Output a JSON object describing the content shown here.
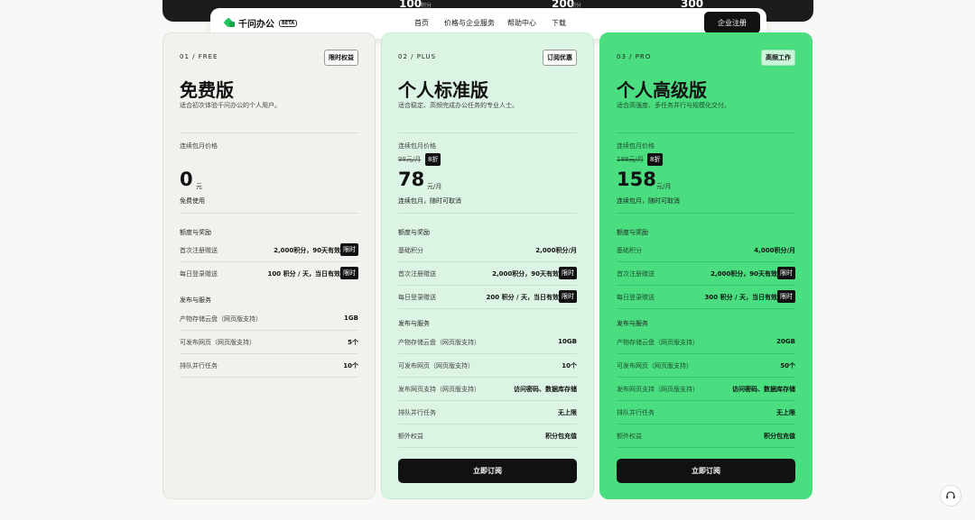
{
  "top_strip": {
    "n1": "100",
    "n2": "200",
    "n3": "300",
    "sub1": "积分",
    "sub2": "积分"
  },
  "nav": {
    "logo_text": "千问办公",
    "beta": "BETA",
    "items": [
      "首页",
      "价格与企业服务",
      "帮助中心",
      "下载"
    ],
    "active": "价格与企业服务",
    "cta": "企业注册"
  },
  "plans": {
    "free": {
      "code": "01 / FREE",
      "tag": "限时权益",
      "name": "免费版",
      "desc": "适合初次体验千问办公的个人用户。",
      "price_label": "连续包月价格",
      "price": "0",
      "unit": "元",
      "note": "免费使用",
      "sec1": "额度与奖励",
      "rows1": [
        {
          "k": "首次注册赠送",
          "v": "2,000积分，90天有效",
          "badge": "限时"
        },
        {
          "k": "每日登录赠送",
          "v": "100 积分 / 天，当日有效",
          "badge": "限时"
        }
      ],
      "sec2": "发布与服务",
      "rows2": [
        {
          "k": "产物存储云盘（网页版支持）",
          "v": "1GB"
        },
        {
          "k": "可发布网页（网页版支持）",
          "v": "5个"
        },
        {
          "k": "排队并行任务",
          "v": "10个"
        }
      ]
    },
    "plus": {
      "code": "02 / PLUS",
      "tag": "订阅优惠",
      "name": "个人标准版",
      "desc": "适合稳定、高频完成办公任务的专业人士。",
      "price_label": "连续包月价格",
      "orig": "98元/月",
      "discount": "8折",
      "price": "78",
      "unit": "元/月",
      "note": "连续包月，随时可取消",
      "sec1": "额度与奖励",
      "rows1": [
        {
          "k": "基础积分",
          "v": "2,000积分/月"
        },
        {
          "k": "首次注册赠送",
          "v": "2,000积分，90天有效",
          "badge": "限时"
        },
        {
          "k": "每日登录赠送",
          "v": "200 积分 / 天，当日有效",
          "badge": "限时"
        }
      ],
      "sec2": "发布与服务",
      "rows2": [
        {
          "k": "产物存储云盘（网页版支持）",
          "v": "10GB"
        },
        {
          "k": "可发布网页（网页版支持）",
          "v": "10个"
        },
        {
          "k": "发布网页支持（网页版支持）",
          "v": "访问密码、数据库存储"
        },
        {
          "k": "排队并行任务",
          "v": "无上限"
        },
        {
          "k": "额外权益",
          "v": "积分包充值"
        }
      ],
      "cta": "立即订阅"
    },
    "pro": {
      "code": "03 / PRO",
      "tag": "高频工作",
      "name": "个人高级版",
      "desc": "适合高强度、多任务并行与规模化交付。",
      "price_label": "连续包月价格",
      "orig": "198元/月",
      "discount": "8折",
      "price": "158",
      "unit": "元/月",
      "note": "连续包月，随时可取消",
      "sec1": "额度与奖励",
      "rows1": [
        {
          "k": "基础积分",
          "v": "4,000积分/月"
        },
        {
          "k": "首次注册赠送",
          "v": "2,000积分，90天有效",
          "badge": "限时"
        },
        {
          "k": "每日登录赠送",
          "v": "300 积分 / 天，当日有效",
          "badge": "限时"
        }
      ],
      "sec2": "发布与服务",
      "rows2": [
        {
          "k": "产物存储云盘（网页版支持）",
          "v": "20GB"
        },
        {
          "k": "可发布网页（网页版支持）",
          "v": "50个"
        },
        {
          "k": "发布网页支持（网页版支持）",
          "v": "访问密码、数据库存储"
        },
        {
          "k": "排队并行任务",
          "v": "无上限"
        },
        {
          "k": "额外权益",
          "v": "积分包充值"
        }
      ],
      "cta": "立即订阅"
    }
  },
  "support_icon": "headset-icon"
}
